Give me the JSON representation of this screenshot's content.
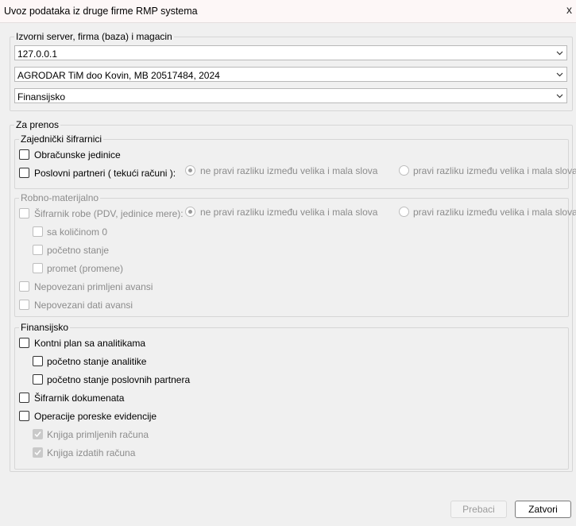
{
  "window": {
    "title": "Uvoz podataka iz druge firme RMP systema",
    "close_label": "x"
  },
  "source": {
    "legend": "Izvorni server, firma (baza) i magacin",
    "server": "127.0.0.1",
    "company": "AGRODAR TiM doo Kovin, MB 20517484, 2024",
    "warehouse": "Finansijsko"
  },
  "transfer": {
    "legend": "Za prenos",
    "common": {
      "legend": "Zajednički šifrarnici",
      "units": "Obračunske jedinice",
      "partners": "Poslovni partneri ( tekući računi ):",
      "case_insensitive": "ne pravi razliku između velika i mala slova",
      "case_sensitive": "pravi razliku između velika i mala slova"
    },
    "goods": {
      "legend": "Robno-materijalno",
      "items": "Šifrarnik robe (PDV, jedinice mere):",
      "case_insensitive": "ne pravi razliku između velika i mala slova",
      "case_sensitive": "pravi razliku između velika i mala slova",
      "with_zero_qty": "sa količinom 0",
      "opening": "početno stanje",
      "turnover": "promet (promene)",
      "unlinked_received": "Nepovezani primljeni avansi",
      "unlinked_given": "Nepovezani dati avansi"
    },
    "finance": {
      "legend": "Finansijsko",
      "chart_of_accounts": "Kontni plan sa analitikama",
      "opening_analytics": "početno stanje analitike",
      "opening_partners": "početno stanje poslovnih partnera",
      "documents": "Šifrarnik dokumenata",
      "tax_ops": "Operacije poreske evidencije",
      "received_invoices": "Knjiga primljenih računa",
      "issued_invoices": "Knjiga izdatih računa"
    }
  },
  "buttons": {
    "transfer": "Prebaci",
    "close": "Zatvori"
  }
}
